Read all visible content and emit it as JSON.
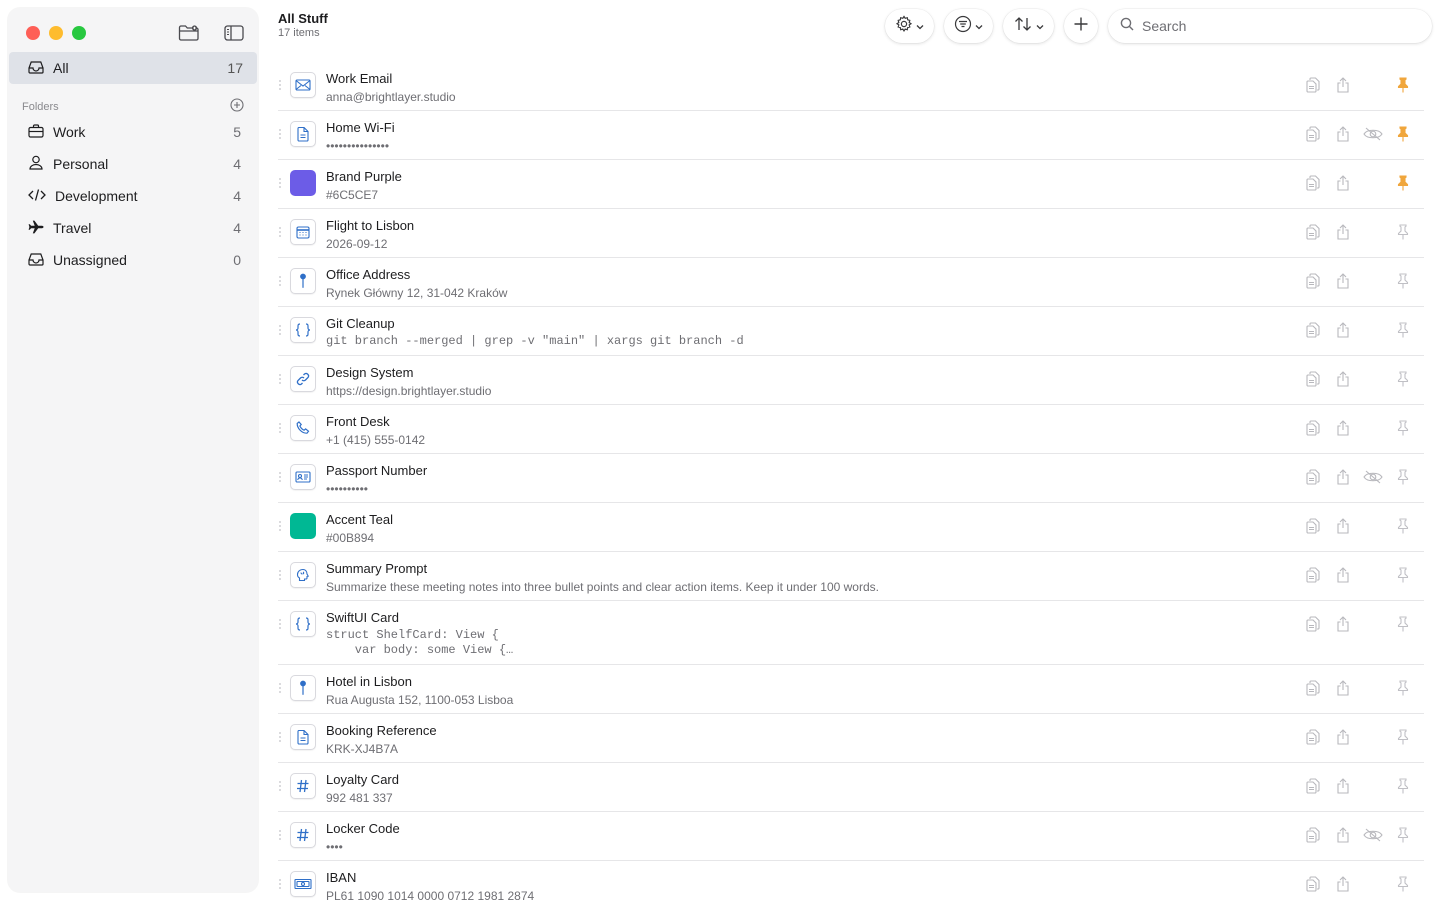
{
  "window": {
    "traffic_lights": [
      "close",
      "minimize",
      "zoom"
    ]
  },
  "sidebar": {
    "all": {
      "label": "All",
      "count": "17",
      "icon": "tray-icon"
    },
    "folders_label": "Folders",
    "folders": [
      {
        "label": "Work",
        "count": "5",
        "icon": "briefcase-icon"
      },
      {
        "label": "Personal",
        "count": "4",
        "icon": "person-icon"
      },
      {
        "label": "Development",
        "count": "4",
        "icon": "code-icon"
      },
      {
        "label": "Travel",
        "count": "4",
        "icon": "airplane-icon"
      },
      {
        "label": "Unassigned",
        "count": "0",
        "icon": "tray-icon"
      }
    ]
  },
  "header": {
    "title": "All Stuff",
    "subtitle": "17 items"
  },
  "toolbar": {
    "search_placeholder": "Search"
  },
  "colors": {
    "accent_pin": "#f0a63c",
    "selection": "#dfe2e8",
    "brand_purple": "#6C5CE7",
    "accent_teal": "#00B894"
  },
  "items": [
    {
      "title": "Work Email",
      "subtitle": "anna@brightlayer.studio",
      "icon": "envelope-icon",
      "pinned": true,
      "hidden": false
    },
    {
      "title": "Home Wi-Fi",
      "subtitle": "•••••••••••••••",
      "icon": "document-icon",
      "pinned": true,
      "hidden": true
    },
    {
      "title": "Brand Purple",
      "subtitle": "#6C5CE7",
      "icon": "color-swatch",
      "color": "#6C5CE7",
      "pinned": true,
      "hidden": false
    },
    {
      "title": "Flight to Lisbon",
      "subtitle": "2026-09-12",
      "icon": "calendar-icon",
      "pinned": false,
      "hidden": false
    },
    {
      "title": "Office Address",
      "subtitle": "Rynek Główny 12, 31-042 Kraków",
      "icon": "map-pin-icon",
      "pinned": false,
      "hidden": false
    },
    {
      "title": "Git Cleanup",
      "subtitle": "git branch --merged | grep -v \"main\" | xargs git branch -d",
      "icon": "braces-icon",
      "mono": true,
      "pinned": false,
      "hidden": false
    },
    {
      "title": "Design System",
      "subtitle": "https://design.brightlayer.studio",
      "icon": "link-icon",
      "pinned": false,
      "hidden": false
    },
    {
      "title": "Front Desk",
      "subtitle": "+1 (415) 555-0142",
      "icon": "phone-icon",
      "pinned": false,
      "hidden": false
    },
    {
      "title": "Passport Number",
      "subtitle": "••••••••••",
      "icon": "id-card-icon",
      "pinned": false,
      "hidden": true
    },
    {
      "title": "Accent Teal",
      "subtitle": "#00B894",
      "icon": "color-swatch",
      "color": "#00B894",
      "pinned": false,
      "hidden": false
    },
    {
      "title": "Summary Prompt",
      "subtitle": "Summarize these meeting notes into three bullet points and clear action items. Keep it under 100 words.",
      "icon": "brain-icon",
      "pinned": false,
      "hidden": false
    },
    {
      "title": "SwiftUI Card",
      "subtitle": "struct ShelfCard: View {\n    var body: some View {…",
      "icon": "braces-icon",
      "mono": true,
      "tall": true,
      "pinned": false,
      "hidden": false
    },
    {
      "title": "Hotel in Lisbon",
      "subtitle": "Rua Augusta 152, 1100-053 Lisboa",
      "icon": "map-pin-icon",
      "pinned": false,
      "hidden": false
    },
    {
      "title": "Booking Reference",
      "subtitle": "KRK-XJ4B7A",
      "icon": "document-icon",
      "pinned": false,
      "hidden": false
    },
    {
      "title": "Loyalty Card",
      "subtitle": "992 481 337",
      "icon": "hash-icon",
      "pinned": false,
      "hidden": false
    },
    {
      "title": "Locker Code",
      "subtitle": "••••",
      "icon": "hash-icon",
      "pinned": false,
      "hidden": true
    },
    {
      "title": "IBAN",
      "subtitle": "PL61 1090 1014 0000 0712 1981 2874",
      "icon": "banknote-icon",
      "pinned": false,
      "hidden": false
    }
  ]
}
